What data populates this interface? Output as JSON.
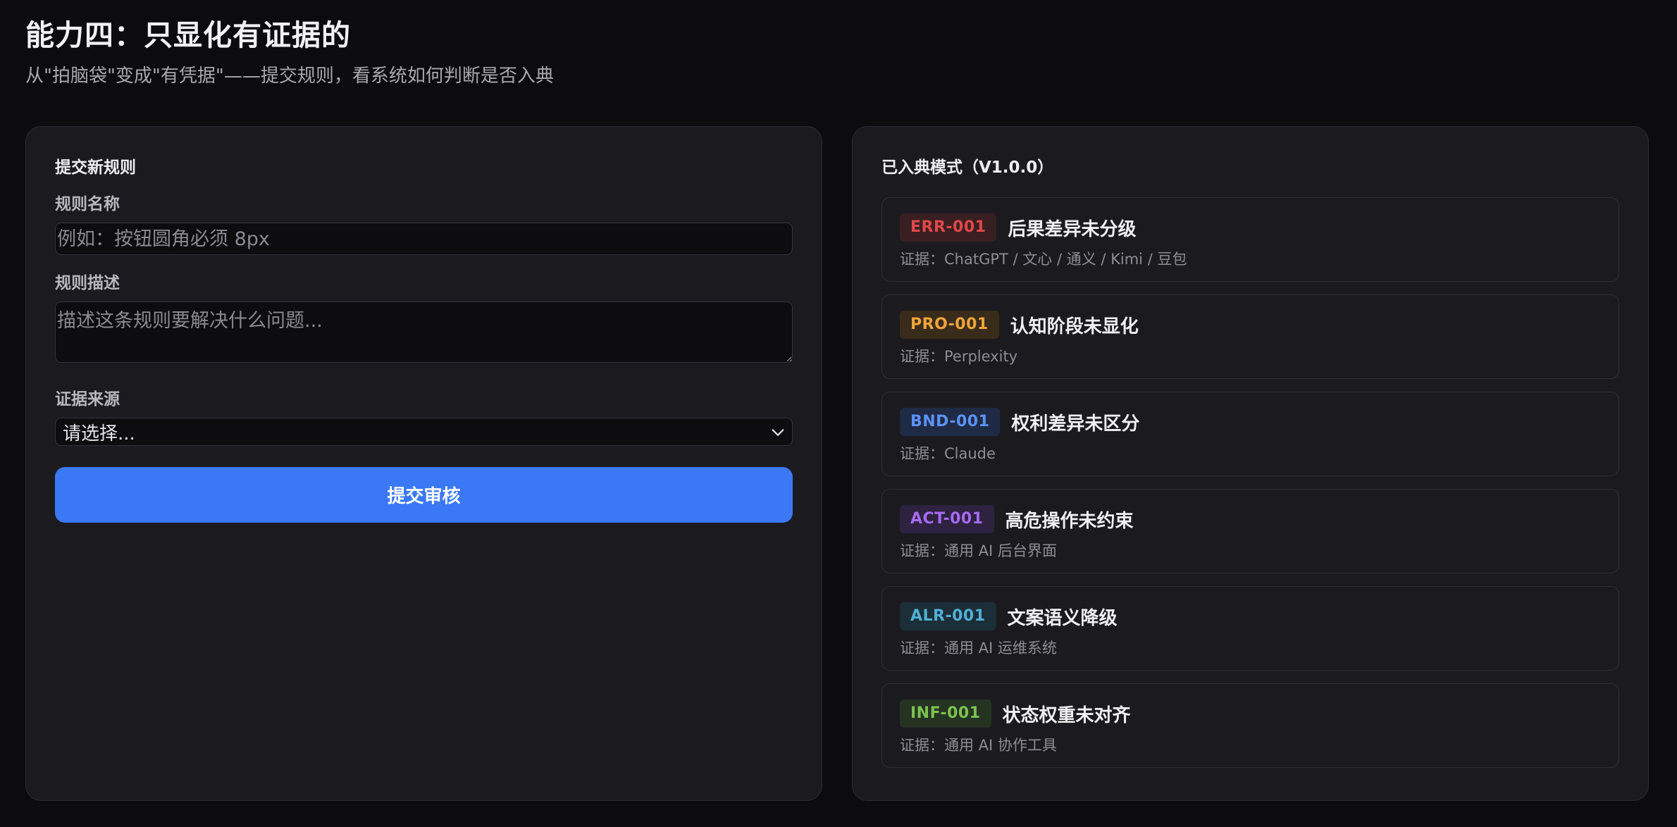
{
  "header": {
    "title": "能力四：只显化有证据的",
    "subtitle": "从\"拍脑袋\"变成\"有凭据\"——提交规则，看系统如何判断是否入典"
  },
  "form": {
    "heading": "提交新规则",
    "name_label": "规则名称",
    "name_placeholder": "例如：按钮圆角必须 8px",
    "desc_label": "规则描述",
    "desc_placeholder": "描述这条规则要解决什么问题...",
    "source_label": "证据来源",
    "source_selected": "请选择...",
    "submit_label": "提交审核"
  },
  "codex": {
    "heading": "已入典模式（V1.0.0）",
    "evidence_prefix": "证据：",
    "rules": [
      {
        "code": "ERR-001",
        "title": "后果差异未分级",
        "evidence": "ChatGPT / 文心 / 通义 / Kimi / 豆包",
        "color": "#e0484a",
        "bg": "#3a1f22"
      },
      {
        "code": "PRO-001",
        "title": "认知阶段未显化",
        "evidence": "Perplexity",
        "color": "#f0a43a",
        "bg": "#3a2c1a"
      },
      {
        "code": "BND-001",
        "title": "权利差异未区分",
        "evidence": "Claude",
        "color": "#5b92f5",
        "bg": "#1f2a44"
      },
      {
        "code": "ACT-001",
        "title": "高危操作未约束",
        "evidence": "通用 AI 后台界面",
        "color": "#a66af2",
        "bg": "#2e2240"
      },
      {
        "code": "ALR-001",
        "title": "文案语义降级",
        "evidence": "通用 AI 运维系统",
        "color": "#4fb0d6",
        "bg": "#1c2e38"
      },
      {
        "code": "INF-001",
        "title": "状态权重未对齐",
        "evidence": "通用 AI 协作工具",
        "color": "#7cc24e",
        "bg": "#253322"
      }
    ]
  }
}
